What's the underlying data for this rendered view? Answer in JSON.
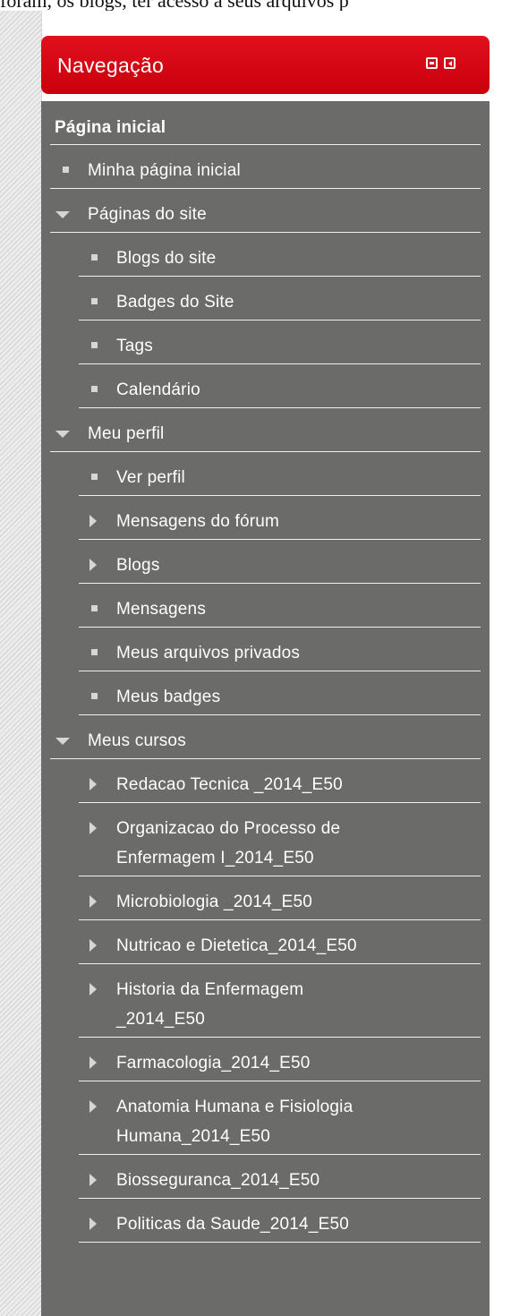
{
  "page": {
    "top_text": "foram, os blogs, ter acesso a seus arquivos p"
  },
  "block": {
    "title": "Navegação",
    "minimize_icon": "minimize-square-icon",
    "dock_icon": "dock-left-arrow-icon",
    "header_color": "#d7000f",
    "body_color": "#6b6b69"
  },
  "nav": {
    "root": "Página inicial",
    "home": "Minha página inicial",
    "site_pages": {
      "label": "Páginas do site",
      "items": [
        "Blogs do site",
        "Badges do Site",
        "Tags",
        "Calendário"
      ]
    },
    "profile": {
      "label": "Meu perfil",
      "items": [
        "Ver perfil",
        "Mensagens do fórum",
        "Blogs",
        "Mensagens",
        "Meus arquivos privados",
        "Meus badges"
      ]
    },
    "courses": {
      "label": "Meus cursos",
      "items": [
        {
          "line1": "Redacao Tecnica _2014_E50",
          "line2": ""
        },
        {
          "line1": "Organizacao do Processo de",
          "line2": "Enfermagem I_2014_E50"
        },
        {
          "line1": "Microbiologia _2014_E50",
          "line2": ""
        },
        {
          "line1": "Nutricao e Dietetica_2014_E50",
          "line2": ""
        },
        {
          "line1": "Historia da Enfermagem",
          "line2": "_2014_E50"
        },
        {
          "line1": "Farmacologia_2014_E50",
          "line2": ""
        },
        {
          "line1": "Anatomia Humana e Fisiologia",
          "line2": "Humana_2014_E50"
        },
        {
          "line1": "Biosseguranca_2014_E50",
          "line2": ""
        },
        {
          "line1": "Politicas da Saude_2014_E50",
          "line2": ""
        }
      ]
    }
  }
}
